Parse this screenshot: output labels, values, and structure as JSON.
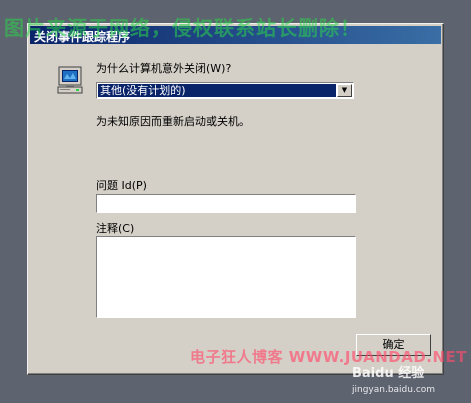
{
  "watermarks": {
    "top": "图片来源于网络，侵权联系站长删除！",
    "bottom": "电子狂人博客 WWW.JUANDAD.NET",
    "logo": "Baidu 经验",
    "url": "jingyan.baidu.com"
  },
  "dialog": {
    "title": "关闭事件跟踪程序",
    "reason_label": "为什么计算机意外关闭(W)?",
    "reason_value": "其他(没有计划的)",
    "description": "为未知原因而重新启动或关机。",
    "problem_id_label": "问题 Id(P)",
    "problem_id_value": "",
    "comment_label": "注释(C)",
    "comment_value": "",
    "ok_label": "确定"
  },
  "icons": {
    "computer": "computer-icon",
    "dropdown": "chevron-down-icon"
  },
  "colors": {
    "titlebar_start": "#0a246a",
    "titlebar_end": "#3a6ea5",
    "dialog_bg": "#d4d0c8",
    "desktop_bg": "#5e6370",
    "selection": "#0a246a"
  }
}
